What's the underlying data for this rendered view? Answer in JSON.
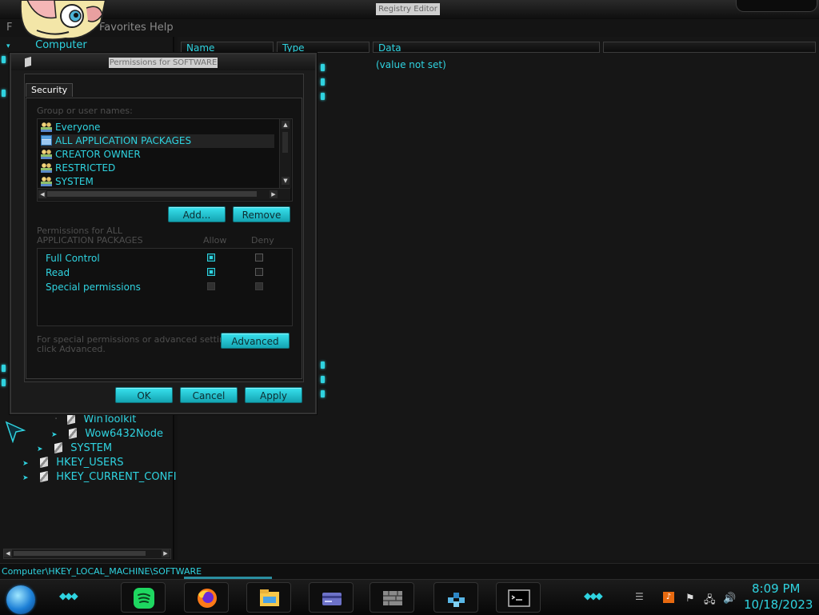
{
  "app": {
    "title": "Registry Editor"
  },
  "menu": {
    "items": [
      "F",
      "Favorites",
      "Help"
    ]
  },
  "list_header": {
    "name": "Name",
    "type": "Type",
    "data": "Data"
  },
  "values": {
    "default_data": "(value not set)"
  },
  "tree": {
    "root": "Computer",
    "items": [
      {
        "label": "WinToolkit",
        "expanded": false
      },
      {
        "label": "Wow6432Node",
        "expanded": false
      },
      {
        "label": "SYSTEM",
        "expanded": false
      },
      {
        "label": "HKEY_USERS",
        "expanded": false
      },
      {
        "label": "HKEY_CURRENT_CONFI",
        "expanded": false
      }
    ]
  },
  "status": {
    "path": "Computer\\HKEY_LOCAL_MACHINE\\SOFTWARE"
  },
  "dialog": {
    "title": "Permissions for SOFTWARE",
    "tab": "Security",
    "group_label": "Group or user names:",
    "groups": [
      {
        "name": "Everyone",
        "icon": "users-icon",
        "selected": false
      },
      {
        "name": "ALL APPLICATION PACKAGES",
        "icon": "package-icon",
        "selected": true
      },
      {
        "name": "CREATOR OWNER",
        "icon": "users-icon",
        "selected": false
      },
      {
        "name": "RESTRICTED",
        "icon": "users-icon",
        "selected": false
      },
      {
        "name": "SYSTEM",
        "icon": "users-icon",
        "selected": false
      }
    ],
    "add_label": "Add...",
    "remove_label": "Remove",
    "perm_header_line1": "Permissions for ALL",
    "perm_header_line2": "APPLICATION PACKAGES",
    "allow_label": "Allow",
    "deny_label": "Deny",
    "permissions": [
      {
        "name": "Full Control",
        "allow": true,
        "deny": false
      },
      {
        "name": "Read",
        "allow": true,
        "deny": false
      },
      {
        "name": "Special permissions",
        "allow": false,
        "deny": false
      }
    ],
    "advanced_note_line1": "For special permissions or advanced settings,",
    "advanced_note_line2": "click Advanced.",
    "advanced_label": "Advanced",
    "ok_label": "OK",
    "cancel_label": "Cancel",
    "apply_label": "Apply"
  },
  "taskbar": {
    "apps": [
      "spotify-icon",
      "firefox-icon",
      "file-explorer-icon",
      "control-panel-icon",
      "firewall-icon",
      "registry-editor-icon",
      "command-prompt-icon"
    ],
    "clock_time": "8:09 PM",
    "clock_date": "10/18/2023"
  },
  "theme": {
    "accent": "#2fd3e0",
    "background": "#141414"
  }
}
